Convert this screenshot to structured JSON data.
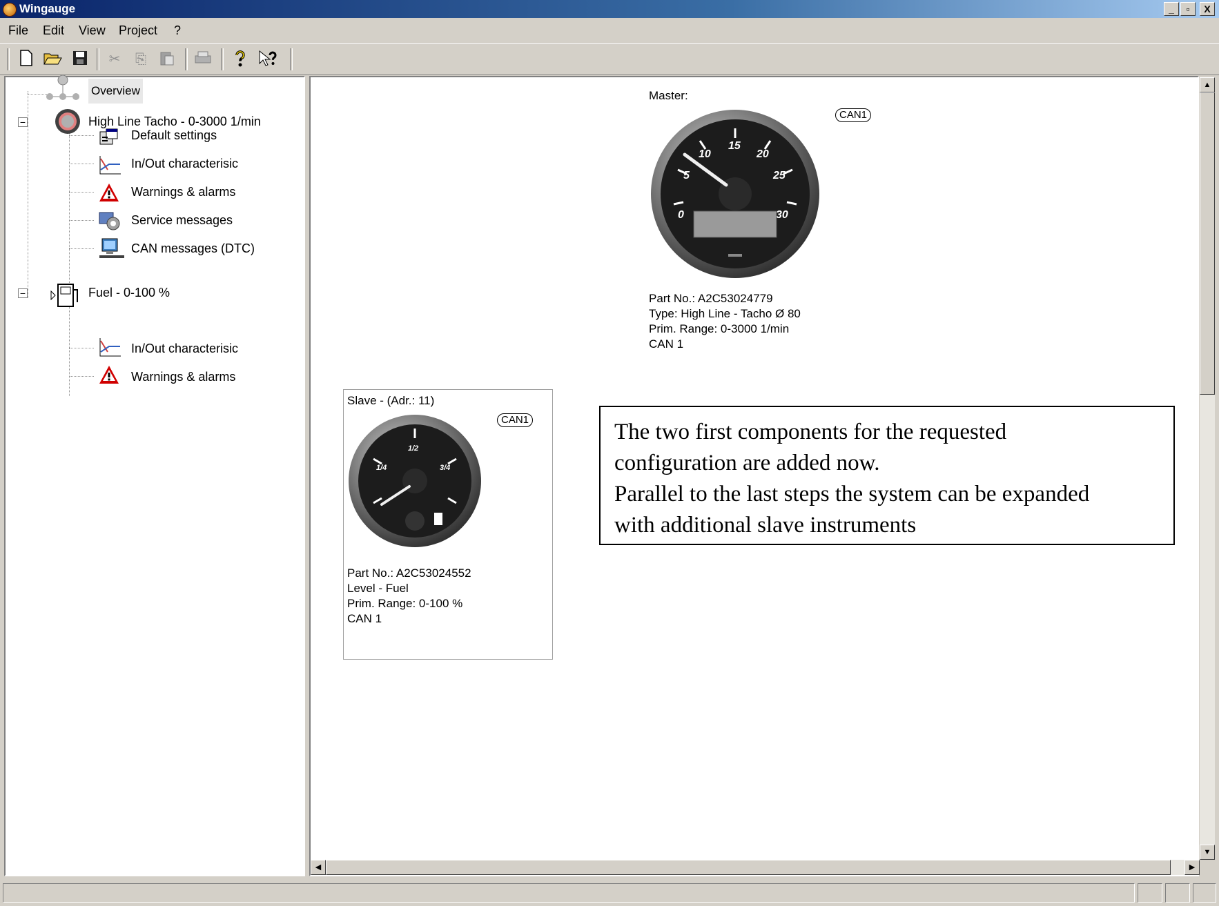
{
  "window": {
    "title": "Wingauge",
    "minimize": "_",
    "maximize": "ð",
    "close": "X"
  },
  "menu": [
    "File",
    "Edit",
    "View",
    "Project",
    "?"
  ],
  "toolbar": {
    "buttons": [
      {
        "name": "new-icon",
        "glyph": "🗋"
      },
      {
        "name": "open-icon",
        "glyph": "📂"
      },
      {
        "name": "save-icon",
        "glyph": "💾"
      },
      {
        "name": "cut-icon",
        "glyph": "✂"
      },
      {
        "name": "copy-icon",
        "glyph": "⎘"
      },
      {
        "name": "paste-icon",
        "glyph": "📋"
      },
      {
        "name": "print-icon",
        "glyph": "🖶"
      },
      {
        "name": "help-icon",
        "glyph": "?"
      },
      {
        "name": "context-help-icon",
        "glyph": "↖?"
      }
    ]
  },
  "tree": {
    "overview": "Overview",
    "master": {
      "label": "High Line Tacho - 0-3000 1/min",
      "children": [
        "Default settings",
        "In/Out characterisic",
        "Warnings & alarms",
        "Service messages",
        "CAN messages (DTC)"
      ]
    },
    "slave": {
      "label": "Fuel - 0-100 %",
      "children": [
        "In/Out characterisic",
        "Warnings & alarms"
      ]
    }
  },
  "master_card": {
    "heading": "Master:",
    "can_badge": "CAN1",
    "gauge_ticks": [
      "0",
      "5",
      "10",
      "15",
      "20",
      "25",
      "30"
    ],
    "lines": [
      "Part No.: A2C53024779",
      "Type: High Line - Tacho Ø 80",
      "Prim. Range: 0-3000 1/min",
      "CAN 1"
    ]
  },
  "slave_card": {
    "heading": "Slave - (Adr.: 11)",
    "can_badge": "CAN1",
    "gauge_ticks": [
      "1/4",
      "1/2",
      "3/4"
    ],
    "lines": [
      "Part No.: A2C53024552",
      "Level - Fuel",
      "Prim. Range: 0-100 %",
      "CAN 1"
    ]
  },
  "callout": {
    "lines": [
      "The two first components for the requested",
      "configuration are added now.",
      "Parallel to the last steps the system can be expanded",
      "with additional slave instruments"
    ]
  },
  "colors": {
    "title_start": "#0a246a",
    "title_end": "#a6caf0",
    "chrome": "#d4d0c8",
    "warning": "#d00000"
  }
}
